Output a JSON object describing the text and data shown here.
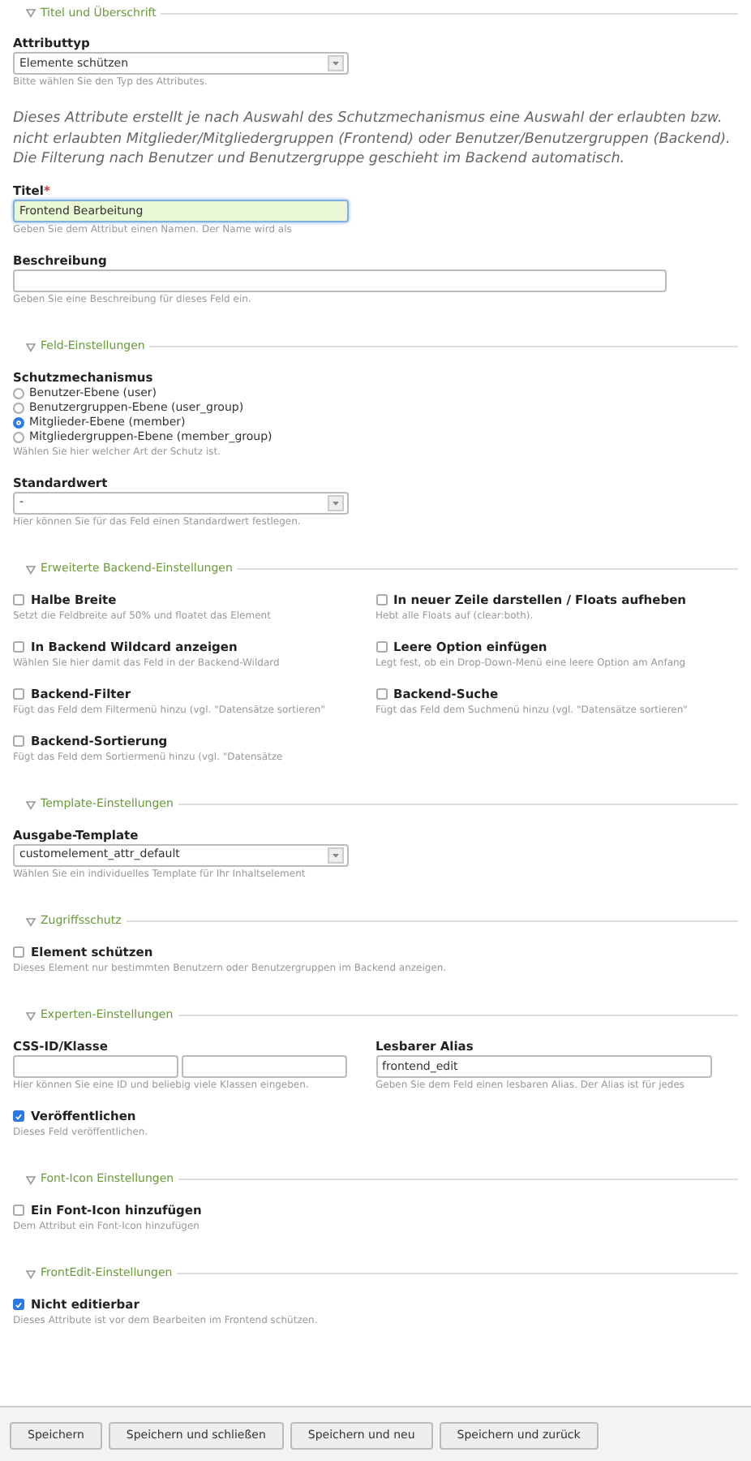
{
  "sections": [
    {
      "legend": "Titel und Überschrift",
      "fields": [
        {
          "kind": "select",
          "label": "Attributtyp",
          "value": "Elemente schützen",
          "help": "Bitte wählen Sie den Typ des Attributes."
        },
        {
          "kind": "note",
          "text": "Dieses Attribute erstellt je nach Auswahl des Schutzmechanismus eine Auswahl der erlaubten bzw. nicht erlaubten Mitglieder/Mitgliedergruppen (Frontend) oder Benutzer/Benutzergruppen (Backend). Die Filterung nach Benutzer und Benutzergruppe geschieht im Backend automatisch."
        },
        {
          "kind": "text",
          "label": "Titel",
          "mark": "*",
          "value": "Frontend Bearbeitung",
          "focused": true,
          "help": "Geben Sie dem Attribut einen Namen. Der Name wird als"
        },
        {
          "kind": "text",
          "label": "Beschreibung",
          "wide": true,
          "help": "Geben Sie eine Beschreibung für dieses Feld ein."
        }
      ]
    },
    {
      "legend": "Feld-Einstellungen",
      "fields": [
        {
          "kind": "radio",
          "label": "Schutzmechanismus",
          "options": [
            {
              "label": "Benutzer-Ebene (user)",
              "selected": false
            },
            {
              "label": "Benutzergruppen-Ebene (user_group)",
              "selected": false
            },
            {
              "label": "Mitglieder-Ebene (member)",
              "selected": true
            },
            {
              "label": "Mitgliedergruppen-Ebene (member_group)",
              "selected": false
            }
          ],
          "help": "Wählen Sie hier welcher Art der Schutz ist."
        },
        {
          "kind": "select",
          "label": "Standardwert",
          "value": "-",
          "help": "Hier können Sie für das Feld einen Standardwert festlegen."
        }
      ]
    },
    {
      "legend": "Erweiterte Backend-Einstellungen",
      "fields": [
        {
          "kind": "columns",
          "fields": [
            {
              "kind": "checkbox",
              "label": "Halbe Breite",
              "checked": false,
              "help": "Setzt die Feldbreite auf 50% und floatet das Element"
            },
            {
              "kind": "checkbox",
              "label": "In neuer Zeile darstellen / Floats aufheben",
              "checked": false,
              "help": "Hebt alle Floats auf (clear:both)."
            },
            {
              "kind": "checkbox",
              "label": "In Backend Wildcard anzeigen",
              "checked": false,
              "help": "Wählen Sie hier damit das Feld in der Backend-Wildard"
            },
            {
              "kind": "checkbox",
              "label": "Leere Option einfügen",
              "checked": false,
              "help": "Legt fest, ob ein Drop-Down-Menü eine leere Option am Anfang"
            },
            {
              "kind": "checkbox",
              "label": "Backend-Filter",
              "checked": false,
              "help": "Fügt das Feld dem Filtermenü hinzu (vgl. \"Datensätze sortieren\""
            },
            {
              "kind": "checkbox",
              "label": "Backend-Suche",
              "checked": false,
              "help": "Fügt das Feld dem Suchmenü hinzu (vgl. \"Datensätze sortieren\""
            },
            {
              "kind": "checkbox",
              "label": "Backend-Sortierung",
              "checked": false,
              "help": "Fügt das Feld dem Sortiermenü hinzu (vgl. \"Datensätze"
            }
          ]
        }
      ]
    },
    {
      "legend": "Template-Einstellungen",
      "fields": [
        {
          "kind": "select",
          "label": "Ausgabe-Template",
          "value": "customelement_attr_default",
          "help": "Wählen Sie ein individuelles Template für Ihr Inhaltselement"
        }
      ]
    },
    {
      "legend": "Zugriffsschutz",
      "fields": [
        {
          "kind": "checkbox",
          "label": "Element schützen",
          "checked": false,
          "help": "Dieses Element nur bestimmten Benutzern oder Benutzergruppen im Backend anzeigen."
        }
      ]
    },
    {
      "legend": "Experten-Einstellungen",
      "fields": [
        {
          "kind": "columns",
          "fields": [
            {
              "kind": "text_pair",
              "label": "CSS-ID/Klasse",
              "help": "Hier können Sie eine ID und beliebig viele Klassen eingeben."
            },
            {
              "kind": "text",
              "label": "Lesbarer Alias",
              "value": "frontend_edit",
              "focused": false,
              "help": "Geben Sie dem Feld einen lesbaren Alias. Der Alias ist für jedes"
            }
          ]
        },
        {
          "kind": "checkbox",
          "label": "Veröffentlichen",
          "checked": true,
          "help": "Dieses Feld veröffentlichen."
        }
      ]
    },
    {
      "legend": "Font-Icon Einstellungen",
      "fields": [
        {
          "kind": "checkbox",
          "label": "Ein Font-Icon hinzufügen",
          "checked": false,
          "help": "Dem Attribut ein Font-Icon hinzufügen"
        }
      ]
    },
    {
      "legend": "FrontEdit-Einstellungen",
      "fields": [
        {
          "kind": "checkbox",
          "label": "Nicht editierbar",
          "checked": true,
          "help": "Dieses Attribute ist vor dem Bearbeiten im Frontend schützen."
        }
      ]
    }
  ],
  "buttons": [
    "Speichern",
    "Speichern und schließen",
    "Speichern und neu",
    "Speichern und zurück"
  ]
}
